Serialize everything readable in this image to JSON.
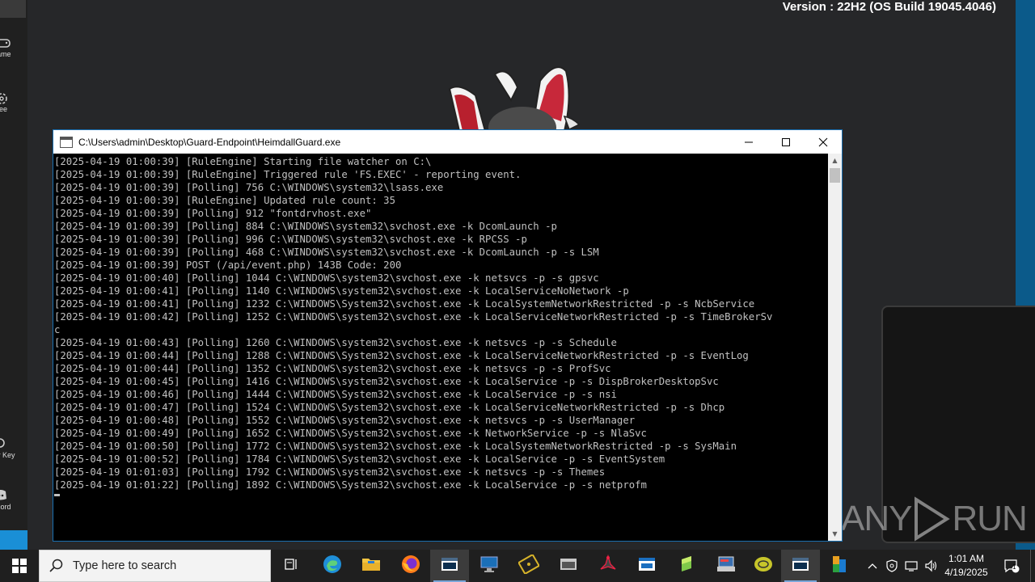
{
  "desktop": {
    "version_text": "Version : 22H2 (OS Build 19045.4046)",
    "left_items": [
      {
        "label": "ame",
        "icon": "gamepad-icon"
      },
      {
        "label": "ree",
        "icon": "gear-icon"
      },
      {
        "label": "y Key",
        "icon": "key-icon"
      },
      {
        "label": "cord",
        "icon": "discord-icon"
      }
    ],
    "watermark": {
      "left": "ANY",
      "right": "RUN"
    }
  },
  "console": {
    "title": "C:\\Users\\admin\\Desktop\\Guard-Endpoint\\HeimdallGuard.exe",
    "lines": [
      "[2025-04-19 01:00:39] [RuleEngine] Starting file watcher on C:\\",
      "[2025-04-19 01:00:39] [RuleEngine] Triggered rule 'FS.EXEC' - reporting event.",
      "[2025-04-19 01:00:39] [Polling] 756 C:\\WINDOWS\\system32\\lsass.exe",
      "[2025-04-19 01:00:39] [RuleEngine] Updated rule count: 35",
      "[2025-04-19 01:00:39] [Polling] 912 \"fontdrvhost.exe\"",
      "[2025-04-19 01:00:39] [Polling] 884 C:\\WINDOWS\\system32\\svchost.exe -k DcomLaunch -p",
      "[2025-04-19 01:00:39] [Polling] 996 C:\\WINDOWS\\system32\\svchost.exe -k RPCSS -p",
      "[2025-04-19 01:00:39] [Polling] 468 C:\\WINDOWS\\system32\\svchost.exe -k DcomLaunch -p -s LSM",
      "[2025-04-19 01:00:39] POST (/api/event.php) 143B Code: 200",
      "[2025-04-19 01:00:40] [Polling] 1044 C:\\WINDOWS\\system32\\svchost.exe -k netsvcs -p -s gpsvc",
      "[2025-04-19 01:00:41] [Polling] 1140 C:\\WINDOWS\\system32\\svchost.exe -k LocalServiceNoNetwork -p",
      "[2025-04-19 01:00:41] [Polling] 1232 C:\\WINDOWS\\System32\\svchost.exe -k LocalSystemNetworkRestricted -p -s NcbService",
      "[2025-04-19 01:00:42] [Polling] 1252 C:\\WINDOWS\\system32\\svchost.exe -k LocalServiceNetworkRestricted -p -s TimeBrokerSv",
      "c",
      "[2025-04-19 01:00:43] [Polling] 1260 C:\\WINDOWS\\system32\\svchost.exe -k netsvcs -p -s Schedule",
      "[2025-04-19 01:00:44] [Polling] 1288 C:\\WINDOWS\\System32\\svchost.exe -k LocalServiceNetworkRestricted -p -s EventLog",
      "[2025-04-19 01:00:44] [Polling] 1352 C:\\WINDOWS\\system32\\svchost.exe -k netsvcs -p -s ProfSvc",
      "[2025-04-19 01:00:45] [Polling] 1416 C:\\WINDOWS\\system32\\svchost.exe -k LocalService -p -s DispBrokerDesktopSvc",
      "[2025-04-19 01:00:46] [Polling] 1444 C:\\WINDOWS\\System32\\svchost.exe -k LocalService -p -s nsi",
      "[2025-04-19 01:00:47] [Polling] 1524 C:\\WINDOWS\\System32\\svchost.exe -k LocalServiceNetworkRestricted -p -s Dhcp",
      "[2025-04-19 01:00:48] [Polling] 1552 C:\\WINDOWS\\system32\\svchost.exe -k netsvcs -p -s UserManager",
      "[2025-04-19 01:00:49] [Polling] 1652 C:\\WINDOWS\\System32\\svchost.exe -k NetworkService -p -s NlaSvc",
      "[2025-04-19 01:00:50] [Polling] 1772 C:\\WINDOWS\\system32\\svchost.exe -k LocalSystemNetworkRestricted -p -s SysMain",
      "[2025-04-19 01:00:52] [Polling] 1784 C:\\WINDOWS\\System32\\svchost.exe -k LocalService -p -s EventSystem",
      "[2025-04-19 01:01:03] [Polling] 1792 C:\\WINDOWS\\system32\\svchost.exe -k netsvcs -p -s Themes",
      "[2025-04-19 01:01:22] [Polling] 1892 C:\\WINDOWS\\System32\\svchost.exe -k LocalService -p -s netprofm"
    ]
  },
  "taskbar": {
    "search_placeholder": "Type here to search",
    "apps": [
      "task-view-icon",
      "edge-icon",
      "file-explorer-icon",
      "firefox-icon",
      "console-app-icon",
      "remote-desktop-icon",
      "circuit-board-icon",
      "terminal-window-icon",
      "acrobat-icon",
      "window-app-icon",
      "green-leaf-icon",
      "tray-app-icon",
      "coin-icon",
      "active-console-icon",
      "office-icon"
    ],
    "time": "1:01 AM",
    "date": "4/19/2025",
    "notification_count": "1"
  },
  "colors": {
    "console_text": "#c0c0c0",
    "console_bg": "#000000",
    "taskbar_bg": "#1f1f1f",
    "accent": "#1a8fd6"
  }
}
